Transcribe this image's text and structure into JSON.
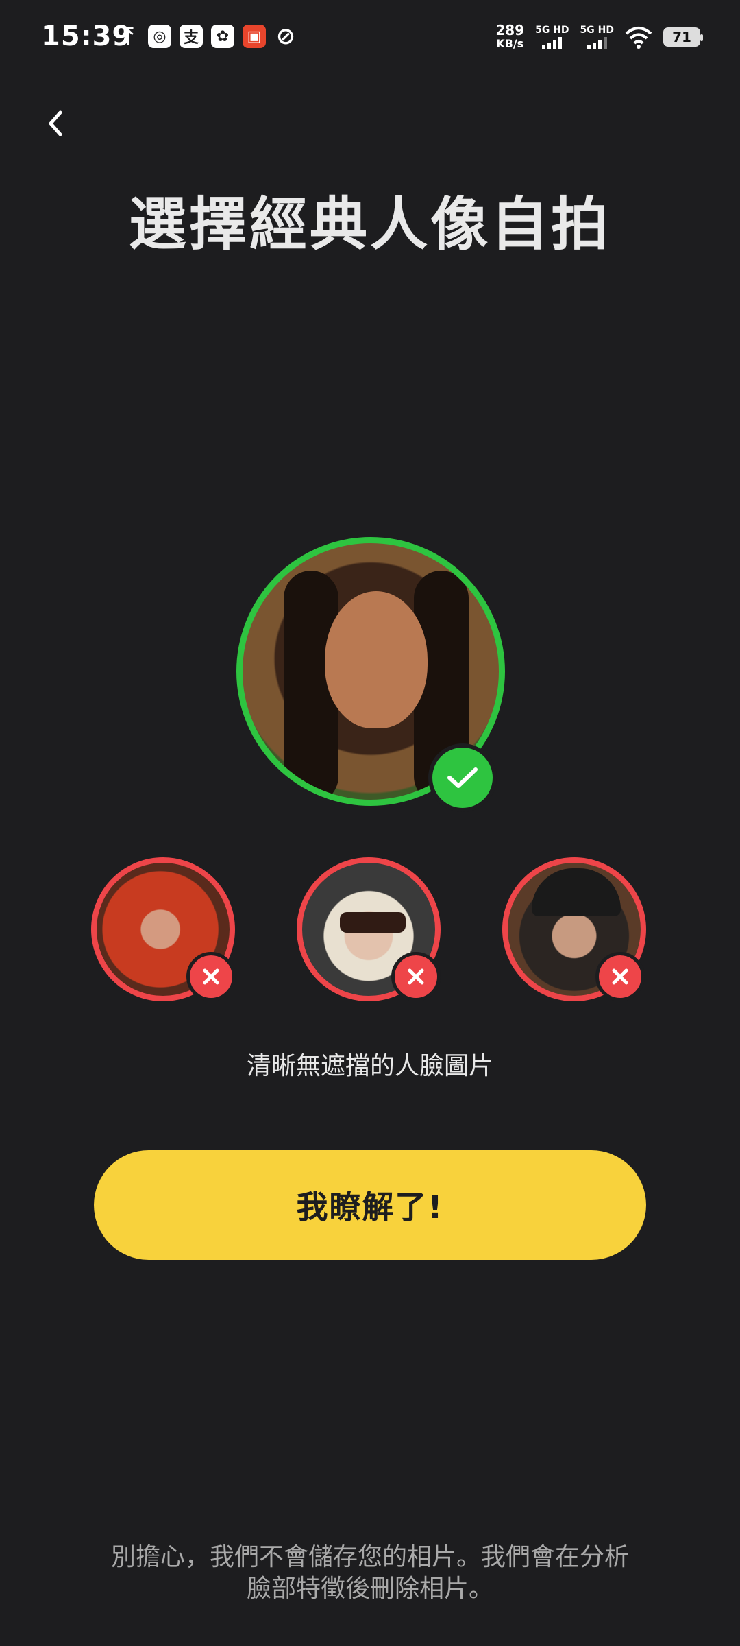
{
  "status_bar": {
    "time": "15:39",
    "net_speed": "289",
    "net_unit": "KB/s",
    "sim1": "5G HD",
    "sim2": "5G HD",
    "battery": "71"
  },
  "header": {
    "title": "選擇經典人像自拍"
  },
  "examples": {
    "good_icon": "check-icon",
    "bad_icon": "close-icon",
    "good_color": "#2ec440",
    "bad_color": "#ee4549"
  },
  "caption": "清晰無遮擋的人臉圖片",
  "cta": {
    "label": "我瞭解了!",
    "color": "#f8d23c"
  },
  "footer": {
    "line1": "別擔心，我們不會儲存您的相片。我們會在分析",
    "line2": "臉部特徵後刪除相片。"
  }
}
